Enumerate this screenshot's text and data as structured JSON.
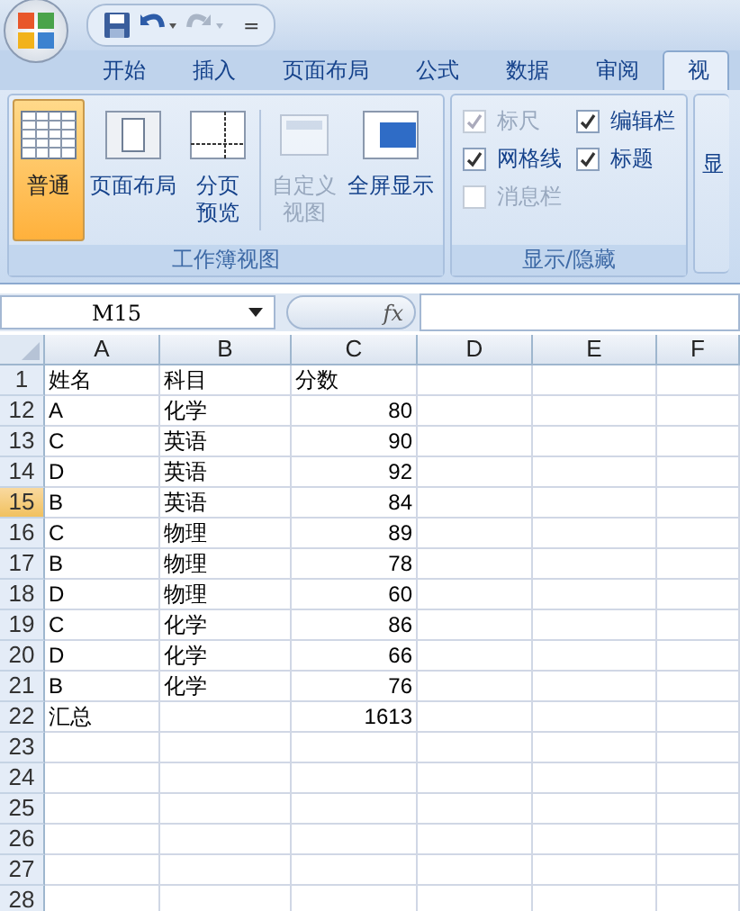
{
  "quick_access": {
    "customize": "="
  },
  "tabs": [
    {
      "label": "开始",
      "selected": false
    },
    {
      "label": "插入",
      "selected": false
    },
    {
      "label": "页面布局",
      "selected": false
    },
    {
      "label": "公式",
      "selected": false
    },
    {
      "label": "数据",
      "selected": false
    },
    {
      "label": "审阅",
      "selected": false
    },
    {
      "label": "视",
      "selected": true
    }
  ],
  "ribbon": {
    "groups": [
      {
        "title": "工作簿视图",
        "kind": "buttons",
        "items": [
          {
            "lines": [
              "普通"
            ],
            "selected": true,
            "disabled": false
          },
          {
            "lines": [
              "页面布局"
            ],
            "selected": false,
            "disabled": false
          },
          {
            "lines": [
              "分页",
              "预览"
            ],
            "selected": false,
            "disabled": false
          },
          {
            "lines": [
              "自定义",
              "视图"
            ],
            "selected": false,
            "disabled": true
          },
          {
            "lines": [
              "全屏显示"
            ],
            "selected": false,
            "disabled": false
          }
        ]
      },
      {
        "title": "显示/隐藏",
        "kind": "checks",
        "items": [
          {
            "label": "标尺",
            "checked": true,
            "disabled": true
          },
          {
            "label": "编辑栏",
            "checked": true,
            "disabled": false
          },
          {
            "label": "网格线",
            "checked": true,
            "disabled": false
          },
          {
            "label": "标题",
            "checked": true,
            "disabled": false
          },
          {
            "label": "消息栏",
            "checked": false,
            "disabled": true
          }
        ]
      },
      {
        "kind": "cut",
        "items": [
          {
            "lines": [
              "显"
            ]
          }
        ]
      }
    ]
  },
  "formula_bar": {
    "name_box": "M15",
    "fx": "fx"
  },
  "sheet": {
    "columns": [
      "A",
      "B",
      "C",
      "D",
      "E",
      "F"
    ],
    "rows": [
      {
        "number": "1",
        "selected": false,
        "cells": [
          "姓名",
          "科目",
          "分数"
        ]
      },
      {
        "number": "12",
        "selected": false,
        "cells": [
          "A",
          "化学",
          "80"
        ]
      },
      {
        "number": "13",
        "selected": false,
        "cells": [
          "C",
          "英语",
          "90"
        ]
      },
      {
        "number": "14",
        "selected": false,
        "cells": [
          "D",
          "英语",
          "92"
        ]
      },
      {
        "number": "15",
        "selected": true,
        "cells": [
          "B",
          "英语",
          "84"
        ]
      },
      {
        "number": "16",
        "selected": false,
        "cells": [
          "C",
          "物理",
          "89"
        ]
      },
      {
        "number": "17",
        "selected": false,
        "cells": [
          "B",
          "物理",
          "78"
        ]
      },
      {
        "number": "18",
        "selected": false,
        "cells": [
          "D",
          "物理",
          "60"
        ]
      },
      {
        "number": "19",
        "selected": false,
        "cells": [
          "C",
          "化学",
          "86"
        ]
      },
      {
        "number": "20",
        "selected": false,
        "cells": [
          "D",
          "化学",
          "66"
        ]
      },
      {
        "number": "21",
        "selected": false,
        "cells": [
          "B",
          "化学",
          "76"
        ]
      },
      {
        "number": "22",
        "selected": false,
        "cells": [
          "汇总",
          "",
          "1613"
        ]
      },
      {
        "number": "23",
        "selected": false
      },
      {
        "number": "24",
        "selected": false
      },
      {
        "number": "25",
        "selected": false
      },
      {
        "number": "26",
        "selected": false
      },
      {
        "number": "27",
        "selected": false
      },
      {
        "number": "28",
        "selected": false
      }
    ]
  }
}
